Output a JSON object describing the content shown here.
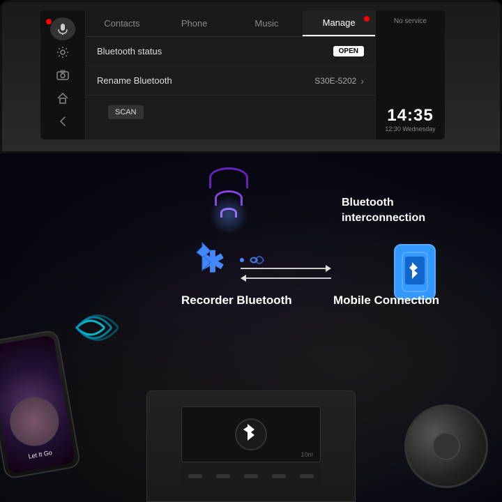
{
  "dashboard": {
    "nav_tabs": [
      {
        "label": "Contacts",
        "active": false
      },
      {
        "label": "Phone",
        "active": false
      },
      {
        "label": "Music",
        "active": false
      },
      {
        "label": "Manage",
        "active": true
      }
    ],
    "menu_items": [
      {
        "label": "Bluetooth status",
        "value_type": "badge",
        "badge_text": "OPEN"
      },
      {
        "label": "Rename Bluetooth",
        "value_type": "device",
        "device_name": "S30E-5202"
      }
    ],
    "scan_button_label": "SCAN",
    "status": {
      "no_service": "No service",
      "time": "14:35",
      "date": "12:30 Wednesday"
    }
  },
  "illustration": {
    "title_interconnect": "Bluetooth\ninterconnection",
    "label_recorder": "Recorder\nBluetooth",
    "label_mobile": "Mobile\nConnection",
    "song_title": "Let It Go",
    "stereo_distance": "10m"
  }
}
